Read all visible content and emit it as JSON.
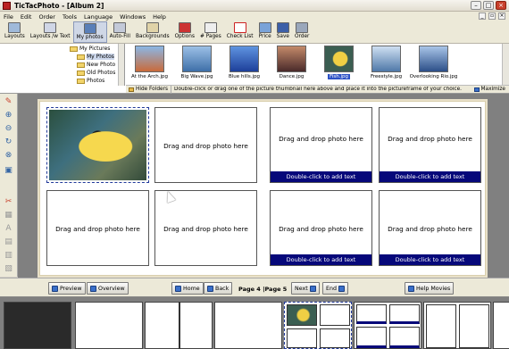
{
  "window": {
    "title": "TicTacPhoto - [Album 2]"
  },
  "menu": [
    "File",
    "Edit",
    "Order",
    "Tools",
    "Language",
    "Windows",
    "Help"
  ],
  "toolbar": [
    {
      "label": "Layouts",
      "icon": "layouts-icon"
    },
    {
      "label": "Layouts /w Text",
      "icon": "layouts-text-icon"
    },
    {
      "label": "My photos",
      "icon": "photos-icon"
    },
    {
      "label": "Auto-Fill",
      "icon": "autofill-icon"
    },
    {
      "label": "Backgrounds",
      "icon": "backgrounds-icon"
    },
    {
      "label": "Options",
      "icon": "options-icon"
    },
    {
      "label": "# Pages",
      "icon": "pages-icon"
    },
    {
      "label": "Check List",
      "icon": "checklist-icon"
    },
    {
      "label": "Price",
      "icon": "price-icon"
    },
    {
      "label": "Save",
      "icon": "save-icon"
    },
    {
      "label": "Order",
      "icon": "order-icon"
    }
  ],
  "tree": [
    "My Pictures",
    "My Photos",
    "New Photo",
    "Old Photos",
    "Photos"
  ],
  "thumbnails": [
    {
      "name": "At the Arch.jpg",
      "color": "#c96a3a"
    },
    {
      "name": "Big Wave.jpg",
      "color": "#5a8fc9"
    },
    {
      "name": "Blue hills.jpg",
      "color": "#2e66c2"
    },
    {
      "name": "Dance.jpg",
      "color": "#7a3a2a"
    },
    {
      "name": "Fish.jpg",
      "color": "#d8b634"
    },
    {
      "name": "Freestyle.jpg",
      "color": "#5f82a8"
    },
    {
      "name": "Overlooking Rio.jpg",
      "color": "#3a5f9a"
    }
  ],
  "hintbar": {
    "hide_folders": "Hide Folders",
    "hint": "Double-click or drag one of the picture thumbnail here above and place it into the pictureframe of your choice.",
    "maximize": "Maximize"
  },
  "frames": {
    "drop_text": "Drag and drop photo here",
    "caption_text": "Double-click to add text"
  },
  "nav": {
    "preview": "Preview",
    "overview": "Overview",
    "home": "Home",
    "back": "Back",
    "page_label": "Page 4",
    "page_label2": "Page 5",
    "next": "Next",
    "end": "End",
    "help": "Help Movies"
  },
  "colors": {
    "caption_bar": "#06087a",
    "workspace": "#808080",
    "selection": "#2d52c6"
  }
}
